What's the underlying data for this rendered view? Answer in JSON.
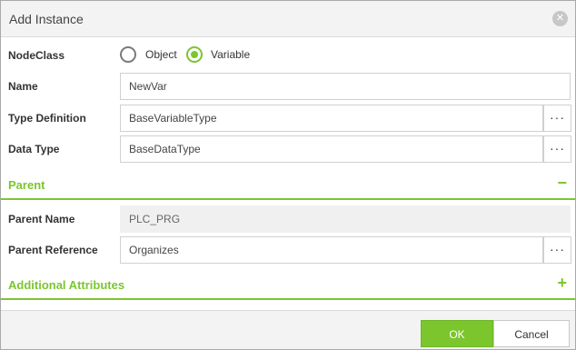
{
  "dialog": {
    "title": "Add Instance",
    "close_icon": "close-icon"
  },
  "form": {
    "nodeclass": {
      "label": "NodeClass",
      "options": [
        {
          "label": "Object",
          "checked": false
        },
        {
          "label": "Variable",
          "checked": true
        }
      ]
    },
    "name": {
      "label": "Name",
      "value": "NewVar"
    },
    "type_definition": {
      "label": "Type Definition",
      "value": "BaseVariableType",
      "button": "···"
    },
    "data_type": {
      "label": "Data Type",
      "value": "BaseDataType",
      "button": "···"
    }
  },
  "parent_section": {
    "title": "Parent",
    "toggle": "−",
    "parent_name": {
      "label": "Parent Name",
      "value": "PLC_PRG"
    },
    "parent_reference": {
      "label": "Parent Reference",
      "value": "Organizes",
      "button": "···"
    }
  },
  "additional_section": {
    "title": "Additional Attributes",
    "toggle": "+"
  },
  "footer": {
    "ok_label": "OK",
    "cancel_label": "Cancel"
  },
  "colors": {
    "accent": "#7bc62d",
    "titlebar": "#f3f3f3",
    "readonly_field": "#f0f0f0"
  }
}
